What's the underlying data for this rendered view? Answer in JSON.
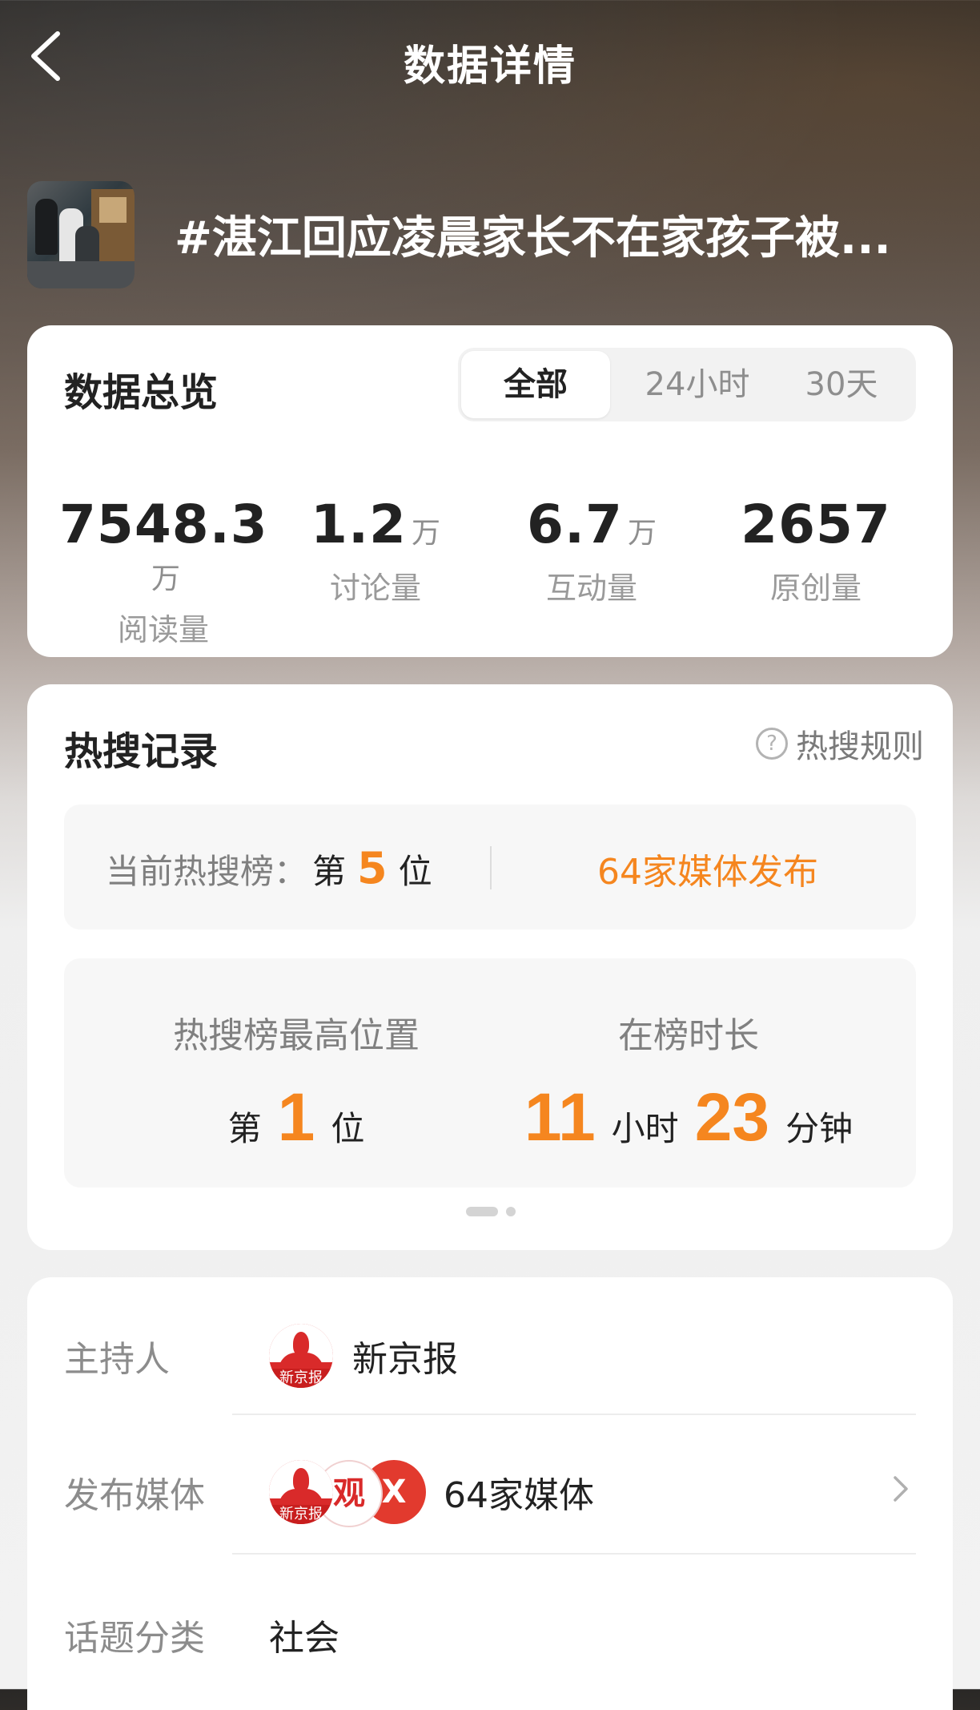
{
  "nav": {
    "title": "数据详情"
  },
  "topic": {
    "title": "#湛江回应凌晨家长不在家孩子被..."
  },
  "overview": {
    "title": "数据总览",
    "tabs": [
      {
        "label": "全部",
        "selected": true
      },
      {
        "label": "24小时",
        "selected": false
      },
      {
        "label": "30天",
        "selected": false
      }
    ],
    "stats": [
      {
        "value": "7548.3",
        "unit": "万",
        "label": "阅读量"
      },
      {
        "value": "1.2",
        "unit": "万",
        "label": "讨论量"
      },
      {
        "value": "6.7",
        "unit": "万",
        "label": "互动量"
      },
      {
        "value": "2657",
        "unit": "",
        "label": "原创量"
      }
    ]
  },
  "hot": {
    "title": "热搜记录",
    "rules_label": "热搜规则",
    "current": {
      "label": "当前热搜榜：",
      "prefix": "第",
      "rank": "5",
      "suffix": "位",
      "media_link": "64家媒体发布"
    },
    "best": {
      "position_label": "热搜榜最高位置",
      "position_prefix": "第",
      "position_value": "1",
      "position_suffix": "位",
      "duration_label": "在榜时长",
      "hours": "11",
      "hours_unit": "小时",
      "minutes": "23",
      "minutes_unit": "分钟"
    }
  },
  "info": {
    "host_label": "主持人",
    "host_name": "新京报",
    "host_logo_text": "新京报",
    "media_label": "发布媒体",
    "media_text": "64家媒体",
    "media_logo2_text": "观",
    "media_logo3_text": "X",
    "category_label": "话题分类",
    "category_value": "社会"
  },
  "colors": {
    "accent": "#f5861f"
  }
}
